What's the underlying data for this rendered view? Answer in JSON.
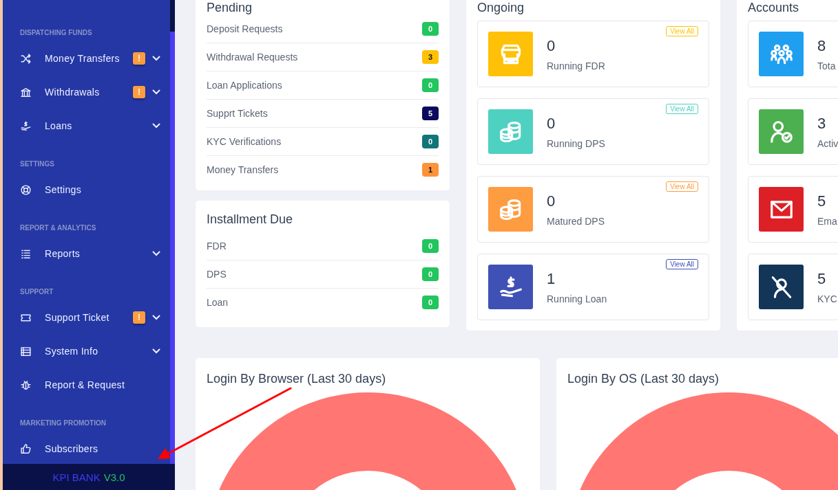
{
  "sidebar": {
    "sections": [
      {
        "title": "DISPATCHING FUNDS",
        "items": [
          {
            "label": "Money Transfers",
            "badge": "!",
            "has_submenu": true
          },
          {
            "label": "Withdrawals",
            "badge": "!",
            "has_submenu": true
          },
          {
            "label": "Loans",
            "has_submenu": true
          }
        ]
      },
      {
        "title": "SETTINGS",
        "items": [
          {
            "label": "Settings",
            "has_submenu": false
          }
        ]
      },
      {
        "title": "REPORT & ANALYTICS",
        "items": [
          {
            "label": "Reports",
            "has_submenu": true
          }
        ]
      },
      {
        "title": "SUPPORT",
        "items": [
          {
            "label": "Support Ticket",
            "badge": "!",
            "has_submenu": true
          },
          {
            "label": "System Info",
            "has_submenu": true
          },
          {
            "label": "Report & Request",
            "has_submenu": false
          }
        ]
      },
      {
        "title": "MARKETING PROMOTION",
        "items": [
          {
            "label": "Subscribers",
            "has_submenu": false
          }
        ]
      }
    ],
    "footer": {
      "brand": "KPI BANK",
      "version": "V3.0"
    }
  },
  "pending": {
    "title": "Pending",
    "rows": [
      {
        "label": "Deposit Requests",
        "count": "0",
        "color": "#22c55e"
      },
      {
        "label": "Withdrawal Requests",
        "count": "3",
        "color": "#ffc107"
      },
      {
        "label": "Loan Applications",
        "count": "0",
        "color": "#22c55e"
      },
      {
        "label": "Supprt Tickets",
        "count": "5",
        "color": "#0c0a5c"
      },
      {
        "label": "KYC Verifications",
        "count": "0",
        "color": "#127578"
      },
      {
        "label": "Money Transfers",
        "count": "1",
        "color": "#fd9339"
      }
    ]
  },
  "installment_due": {
    "title": "Installment Due",
    "rows": [
      {
        "label": "FDR",
        "count": "0",
        "color": "#22c55e"
      },
      {
        "label": "DPS",
        "count": "0",
        "color": "#22c55e"
      },
      {
        "label": "Loan",
        "count": "0",
        "color": "#22c55e"
      }
    ]
  },
  "ongoing": {
    "title": "Ongoing",
    "items": [
      {
        "value": "0",
        "label": "Running FDR",
        "color": "#ffc107",
        "link": "View All"
      },
      {
        "value": "0",
        "label": "Running DPS",
        "color": "#4fd1c1",
        "link": "View All"
      },
      {
        "value": "0",
        "label": "Matured DPS",
        "color": "#fd9c40",
        "link": "View All"
      },
      {
        "value": "1",
        "label": "Running Loan",
        "color": "#3f51b5",
        "link": "View All"
      }
    ]
  },
  "accounts": {
    "title": "Accounts",
    "items": [
      {
        "value": "8",
        "label": "Tota",
        "color": "#1f9ff0"
      },
      {
        "value": "3",
        "label": "Activ",
        "color": "#4caf50"
      },
      {
        "value": "5",
        "label": "Ema",
        "color": "#dc2026"
      },
      {
        "value": "5",
        "label": "KYC",
        "color": "#123558"
      }
    ]
  },
  "charts": [
    {
      "title": "Login By Browser (Last 30 days)"
    },
    {
      "title": "Login By OS (Last 30 days)"
    }
  ]
}
